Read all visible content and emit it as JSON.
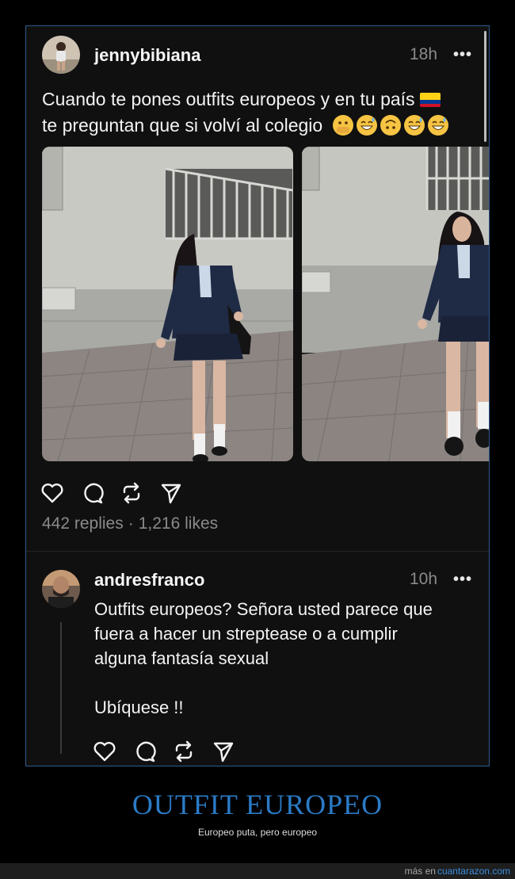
{
  "post": {
    "username": "jennybibiana",
    "time": "18h",
    "more": "•••",
    "text_line1": "Cuando te pones outfits europeos y en tu país",
    "text_line2": "te preguntan que si volví al colegio",
    "replies": "442 replies",
    "dot": "·",
    "likes": "1,216 likes"
  },
  "reply": {
    "username": "andresfranco",
    "time": "10h",
    "more": "•••",
    "text": "Outfits europeos? Señora usted parece que\nfuera a hacer un streptease o a cumplir\nalguna fantasía sexual\n\nUbíquese !!"
  },
  "icons": [
    "heart-icon",
    "comment-icon",
    "repost-icon",
    "share-icon"
  ],
  "caption": {
    "title": "OUTFIT EUROPEO",
    "subtitle": "Europeo puta, pero europeo"
  },
  "footer": {
    "prefix": "más en",
    "link": "cuantarazon.com"
  },
  "colors": {
    "accent": "#2a7bc6",
    "frame_border": "#2d5a8c",
    "card_bg": "#101010",
    "muted_text": "#8a8a8a"
  }
}
